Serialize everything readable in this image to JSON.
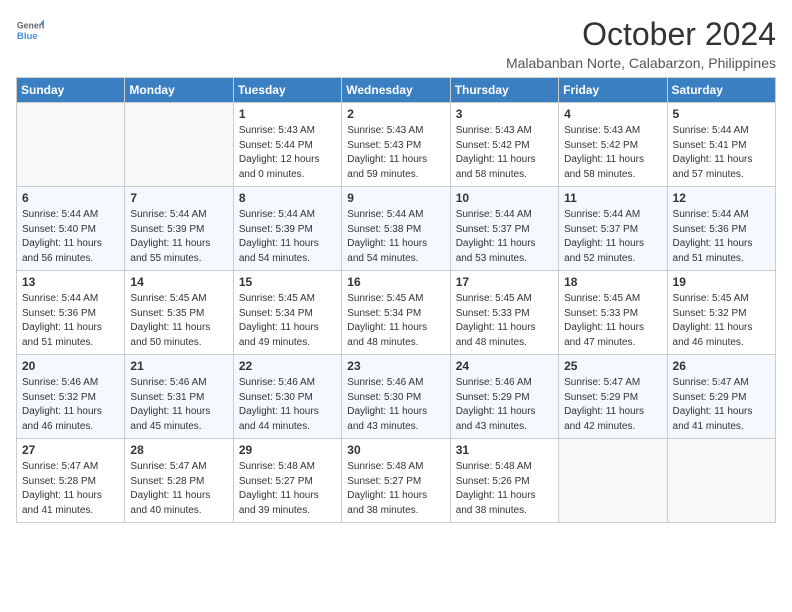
{
  "logo": {
    "text_general": "General",
    "text_blue": "Blue"
  },
  "header": {
    "month": "October 2024",
    "location": "Malabanban Norte, Calabarzon, Philippines"
  },
  "weekdays": [
    "Sunday",
    "Monday",
    "Tuesday",
    "Wednesday",
    "Thursday",
    "Friday",
    "Saturday"
  ],
  "weeks": [
    [
      {
        "day": "",
        "sunrise": "",
        "sunset": "",
        "daylight": ""
      },
      {
        "day": "",
        "sunrise": "",
        "sunset": "",
        "daylight": ""
      },
      {
        "day": "1",
        "sunrise": "Sunrise: 5:43 AM",
        "sunset": "Sunset: 5:44 PM",
        "daylight": "Daylight: 12 hours and 0 minutes."
      },
      {
        "day": "2",
        "sunrise": "Sunrise: 5:43 AM",
        "sunset": "Sunset: 5:43 PM",
        "daylight": "Daylight: 11 hours and 59 minutes."
      },
      {
        "day": "3",
        "sunrise": "Sunrise: 5:43 AM",
        "sunset": "Sunset: 5:42 PM",
        "daylight": "Daylight: 11 hours and 58 minutes."
      },
      {
        "day": "4",
        "sunrise": "Sunrise: 5:43 AM",
        "sunset": "Sunset: 5:42 PM",
        "daylight": "Daylight: 11 hours and 58 minutes."
      },
      {
        "day": "5",
        "sunrise": "Sunrise: 5:44 AM",
        "sunset": "Sunset: 5:41 PM",
        "daylight": "Daylight: 11 hours and 57 minutes."
      }
    ],
    [
      {
        "day": "6",
        "sunrise": "Sunrise: 5:44 AM",
        "sunset": "Sunset: 5:40 PM",
        "daylight": "Daylight: 11 hours and 56 minutes."
      },
      {
        "day": "7",
        "sunrise": "Sunrise: 5:44 AM",
        "sunset": "Sunset: 5:39 PM",
        "daylight": "Daylight: 11 hours and 55 minutes."
      },
      {
        "day": "8",
        "sunrise": "Sunrise: 5:44 AM",
        "sunset": "Sunset: 5:39 PM",
        "daylight": "Daylight: 11 hours and 54 minutes."
      },
      {
        "day": "9",
        "sunrise": "Sunrise: 5:44 AM",
        "sunset": "Sunset: 5:38 PM",
        "daylight": "Daylight: 11 hours and 54 minutes."
      },
      {
        "day": "10",
        "sunrise": "Sunrise: 5:44 AM",
        "sunset": "Sunset: 5:37 PM",
        "daylight": "Daylight: 11 hours and 53 minutes."
      },
      {
        "day": "11",
        "sunrise": "Sunrise: 5:44 AM",
        "sunset": "Sunset: 5:37 PM",
        "daylight": "Daylight: 11 hours and 52 minutes."
      },
      {
        "day": "12",
        "sunrise": "Sunrise: 5:44 AM",
        "sunset": "Sunset: 5:36 PM",
        "daylight": "Daylight: 11 hours and 51 minutes."
      }
    ],
    [
      {
        "day": "13",
        "sunrise": "Sunrise: 5:44 AM",
        "sunset": "Sunset: 5:36 PM",
        "daylight": "Daylight: 11 hours and 51 minutes."
      },
      {
        "day": "14",
        "sunrise": "Sunrise: 5:45 AM",
        "sunset": "Sunset: 5:35 PM",
        "daylight": "Daylight: 11 hours and 50 minutes."
      },
      {
        "day": "15",
        "sunrise": "Sunrise: 5:45 AM",
        "sunset": "Sunset: 5:34 PM",
        "daylight": "Daylight: 11 hours and 49 minutes."
      },
      {
        "day": "16",
        "sunrise": "Sunrise: 5:45 AM",
        "sunset": "Sunset: 5:34 PM",
        "daylight": "Daylight: 11 hours and 48 minutes."
      },
      {
        "day": "17",
        "sunrise": "Sunrise: 5:45 AM",
        "sunset": "Sunset: 5:33 PM",
        "daylight": "Daylight: 11 hours and 48 minutes."
      },
      {
        "day": "18",
        "sunrise": "Sunrise: 5:45 AM",
        "sunset": "Sunset: 5:33 PM",
        "daylight": "Daylight: 11 hours and 47 minutes."
      },
      {
        "day": "19",
        "sunrise": "Sunrise: 5:45 AM",
        "sunset": "Sunset: 5:32 PM",
        "daylight": "Daylight: 11 hours and 46 minutes."
      }
    ],
    [
      {
        "day": "20",
        "sunrise": "Sunrise: 5:46 AM",
        "sunset": "Sunset: 5:32 PM",
        "daylight": "Daylight: 11 hours and 46 minutes."
      },
      {
        "day": "21",
        "sunrise": "Sunrise: 5:46 AM",
        "sunset": "Sunset: 5:31 PM",
        "daylight": "Daylight: 11 hours and 45 minutes."
      },
      {
        "day": "22",
        "sunrise": "Sunrise: 5:46 AM",
        "sunset": "Sunset: 5:30 PM",
        "daylight": "Daylight: 11 hours and 44 minutes."
      },
      {
        "day": "23",
        "sunrise": "Sunrise: 5:46 AM",
        "sunset": "Sunset: 5:30 PM",
        "daylight": "Daylight: 11 hours and 43 minutes."
      },
      {
        "day": "24",
        "sunrise": "Sunrise: 5:46 AM",
        "sunset": "Sunset: 5:29 PM",
        "daylight": "Daylight: 11 hours and 43 minutes."
      },
      {
        "day": "25",
        "sunrise": "Sunrise: 5:47 AM",
        "sunset": "Sunset: 5:29 PM",
        "daylight": "Daylight: 11 hours and 42 minutes."
      },
      {
        "day": "26",
        "sunrise": "Sunrise: 5:47 AM",
        "sunset": "Sunset: 5:29 PM",
        "daylight": "Daylight: 11 hours and 41 minutes."
      }
    ],
    [
      {
        "day": "27",
        "sunrise": "Sunrise: 5:47 AM",
        "sunset": "Sunset: 5:28 PM",
        "daylight": "Daylight: 11 hours and 41 minutes."
      },
      {
        "day": "28",
        "sunrise": "Sunrise: 5:47 AM",
        "sunset": "Sunset: 5:28 PM",
        "daylight": "Daylight: 11 hours and 40 minutes."
      },
      {
        "day": "29",
        "sunrise": "Sunrise: 5:48 AM",
        "sunset": "Sunset: 5:27 PM",
        "daylight": "Daylight: 11 hours and 39 minutes."
      },
      {
        "day": "30",
        "sunrise": "Sunrise: 5:48 AM",
        "sunset": "Sunset: 5:27 PM",
        "daylight": "Daylight: 11 hours and 38 minutes."
      },
      {
        "day": "31",
        "sunrise": "Sunrise: 5:48 AM",
        "sunset": "Sunset: 5:26 PM",
        "daylight": "Daylight: 11 hours and 38 minutes."
      },
      {
        "day": "",
        "sunrise": "",
        "sunset": "",
        "daylight": ""
      },
      {
        "day": "",
        "sunrise": "",
        "sunset": "",
        "daylight": ""
      }
    ]
  ]
}
